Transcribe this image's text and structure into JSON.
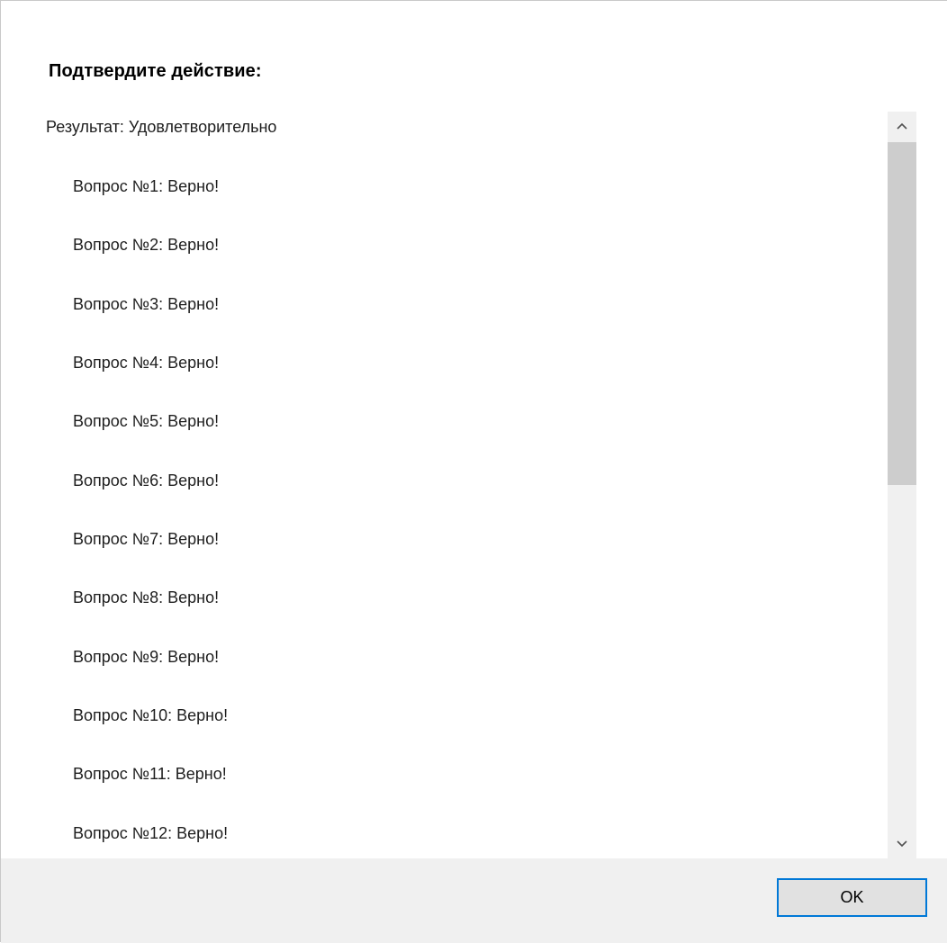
{
  "dialog": {
    "title": "Подтвердите действие:"
  },
  "content": {
    "result": "Результат: Удовлетворительно",
    "questions": [
      "Вопрос №1: Верно!",
      "Вопрос №2: Верно!",
      "Вопрос №3: Верно!",
      "Вопрос №4: Верно!",
      "Вопрос №5: Верно!",
      "Вопрос №6: Верно!",
      "Вопрос №7: Верно!",
      "Вопрос №8: Верно!",
      "Вопрос №9: Верно!",
      "Вопрос №10: Верно!",
      "Вопрос №11: Верно!",
      "Вопрос №12: Верно!"
    ]
  },
  "scrollbar": {
    "up_icon": "chevron-up-icon",
    "down_icon": "chevron-down-icon"
  },
  "footer": {
    "ok_label": "OK"
  },
  "colors": {
    "focus_border": "#0078d7",
    "button_bg": "#e1e1e1",
    "footer_bg": "#f0f0f0",
    "thumb": "#cdcdcd"
  }
}
